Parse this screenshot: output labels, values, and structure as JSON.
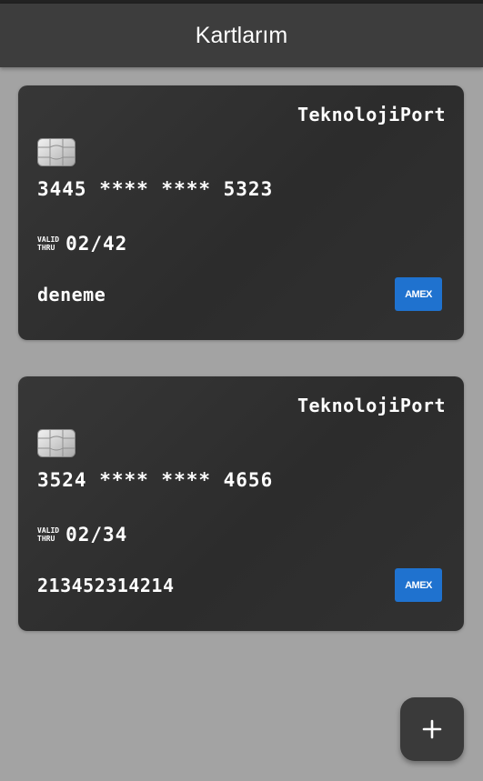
{
  "appbar": {
    "title": "Kartlarım"
  },
  "cards": [
    {
      "bank": "TeknolojiPort",
      "number": "3445 **** **** 5323",
      "valid_label_top": "VALID",
      "valid_label_bottom": "THRU",
      "expiry": "02/42",
      "holder": "deneme",
      "brand": "AMEX",
      "brand_color": "#1f72cf"
    },
    {
      "bank": "TeknolojiPort",
      "number": "3524 **** **** 4656",
      "valid_label_top": "VALID",
      "valid_label_bottom": "THRU",
      "expiry": "02/34",
      "holder": "213452314214",
      "brand": "AMEX",
      "brand_color": "#1f72cf"
    }
  ],
  "fab": {
    "icon": "plus-icon"
  },
  "colors": {
    "background": "#a3a3a3",
    "appbar": "#3d3d3d",
    "card": "#2f2f2f"
  }
}
